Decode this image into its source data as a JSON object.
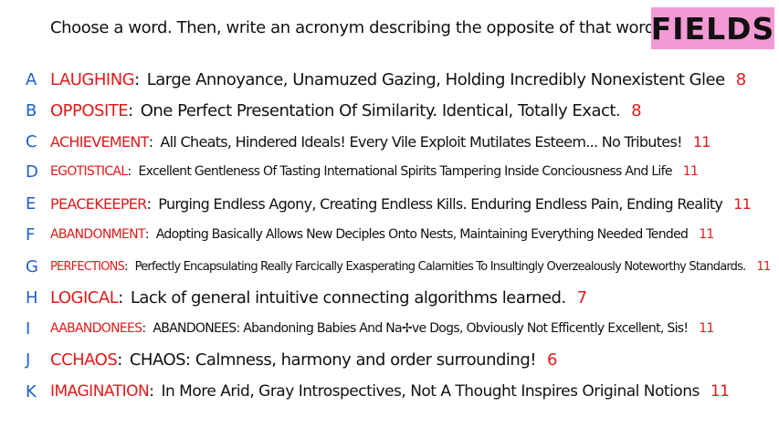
{
  "prompt": "Choose a word. Then, write an acronym describing the opposite of that word!",
  "badge": "FIELDS",
  "colors": {
    "letter": "#1f5fc8",
    "word": "#e01a1a",
    "badge_bg": "#f39ad5"
  },
  "rows": [
    {
      "letter": "A",
      "word": "LAUGHING",
      "desc": "Large Annoyance, Unamuzed Gazing, Holding Incredibly Nonexistent Glee",
      "score": "8"
    },
    {
      "letter": "B",
      "word": "OPPOSITE",
      "desc": "One Perfect Presentation Of Similarity. Identical, Totally Exact.",
      "score": "8"
    },
    {
      "letter": "C",
      "word": "ACHIEVEMENT",
      "desc": "All Cheats, Hindered Ideals! Every Vile Exploit Mutilates Esteem... No Tributes!",
      "score": "11"
    },
    {
      "letter": "D",
      "word": "EGOTISTICAL",
      "desc": "Excellent Gentleness Of Tasting International Spirits Tampering Inside Conciousness And Life",
      "score": "11"
    },
    {
      "letter": "E",
      "word": "PEACEKEEPER",
      "desc": "Purging Endless Agony, Creating Endless Kills. Enduring Endless Pain, Ending Reality",
      "score": "11"
    },
    {
      "letter": "F",
      "word": "ABANDONMENT",
      "desc": "Adopting Basically Allows New Deciples Onto Nests, Maintaining Everything Needed Tended",
      "score": "11"
    },
    {
      "letter": "G",
      "word": "PERFECTIONS",
      "desc": "Perfectly Encapsulating Really Farcically Exasperating Calamities To Insultingly Overzealously Noteworthy Standards.",
      "score": "11"
    },
    {
      "letter": "H",
      "word": "LOGICAL",
      "desc": "Lack of general intuitive connecting algorithms learned.",
      "score": "7"
    },
    {
      "letter": "I",
      "word": "AABANDONEES",
      "desc": "ABANDONEES: Abandoning Babies And Na✢ve Dogs, Obviously Not Efficently Excellent, Sis!",
      "score": "11"
    },
    {
      "letter": "J",
      "word": "CCHAOS",
      "desc": "CHAOS: Calmness, harmony and order surrounding!",
      "score": "6"
    },
    {
      "letter": "K",
      "word": "IMAGINATION",
      "desc": "In More Arid, Gray Introspectives, Not A Thought Inspires Original Notions",
      "score": "11"
    }
  ]
}
